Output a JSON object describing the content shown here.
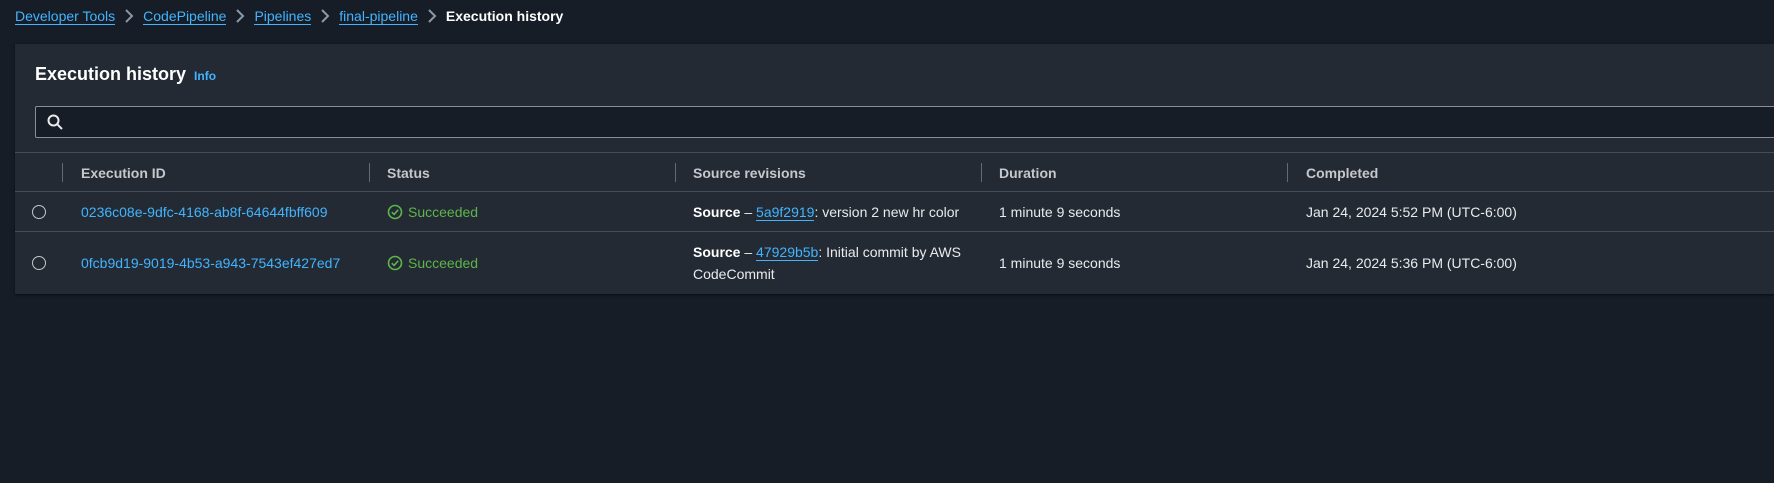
{
  "breadcrumb": {
    "items": [
      "Developer Tools",
      "CodePipeline",
      "Pipelines",
      "final-pipeline"
    ],
    "current": "Execution history"
  },
  "panel": {
    "title": "Execution history",
    "info": "Info"
  },
  "search": {
    "value": "",
    "placeholder": ""
  },
  "table": {
    "columns": [
      "Execution ID",
      "Status",
      "Source revisions",
      "Duration",
      "Completed"
    ],
    "rows": [
      {
        "execution_id": "0236c08e-9dfc-4168-ab8f-64644fbff609",
        "status": "Succeeded",
        "source_label": "Source",
        "source_sep": " – ",
        "commit": "5a9f2919",
        "message": ": version 2 new hr color",
        "duration": "1 minute 9 seconds",
        "completed": "Jan 24, 2024 5:52 PM (UTC-6:00)"
      },
      {
        "execution_id": "0fcb9d19-9019-4b53-a943-7543ef427ed7",
        "status": "Succeeded",
        "source_label": "Source",
        "source_sep": " – ",
        "commit": "47929b5b",
        "message": ": Initial commit by AWS CodeCommit",
        "duration": "1 minute 9 seconds",
        "completed": "Jan 24, 2024 5:36 PM (UTC-6:00)"
      }
    ]
  },
  "colors": {
    "page_bg": "#161d26",
    "panel_bg": "#232a33",
    "link": "#42b4ff",
    "success": "#5fb54b"
  },
  "icons": [
    "chevron-right-icon",
    "search-icon",
    "success-check-icon"
  ]
}
